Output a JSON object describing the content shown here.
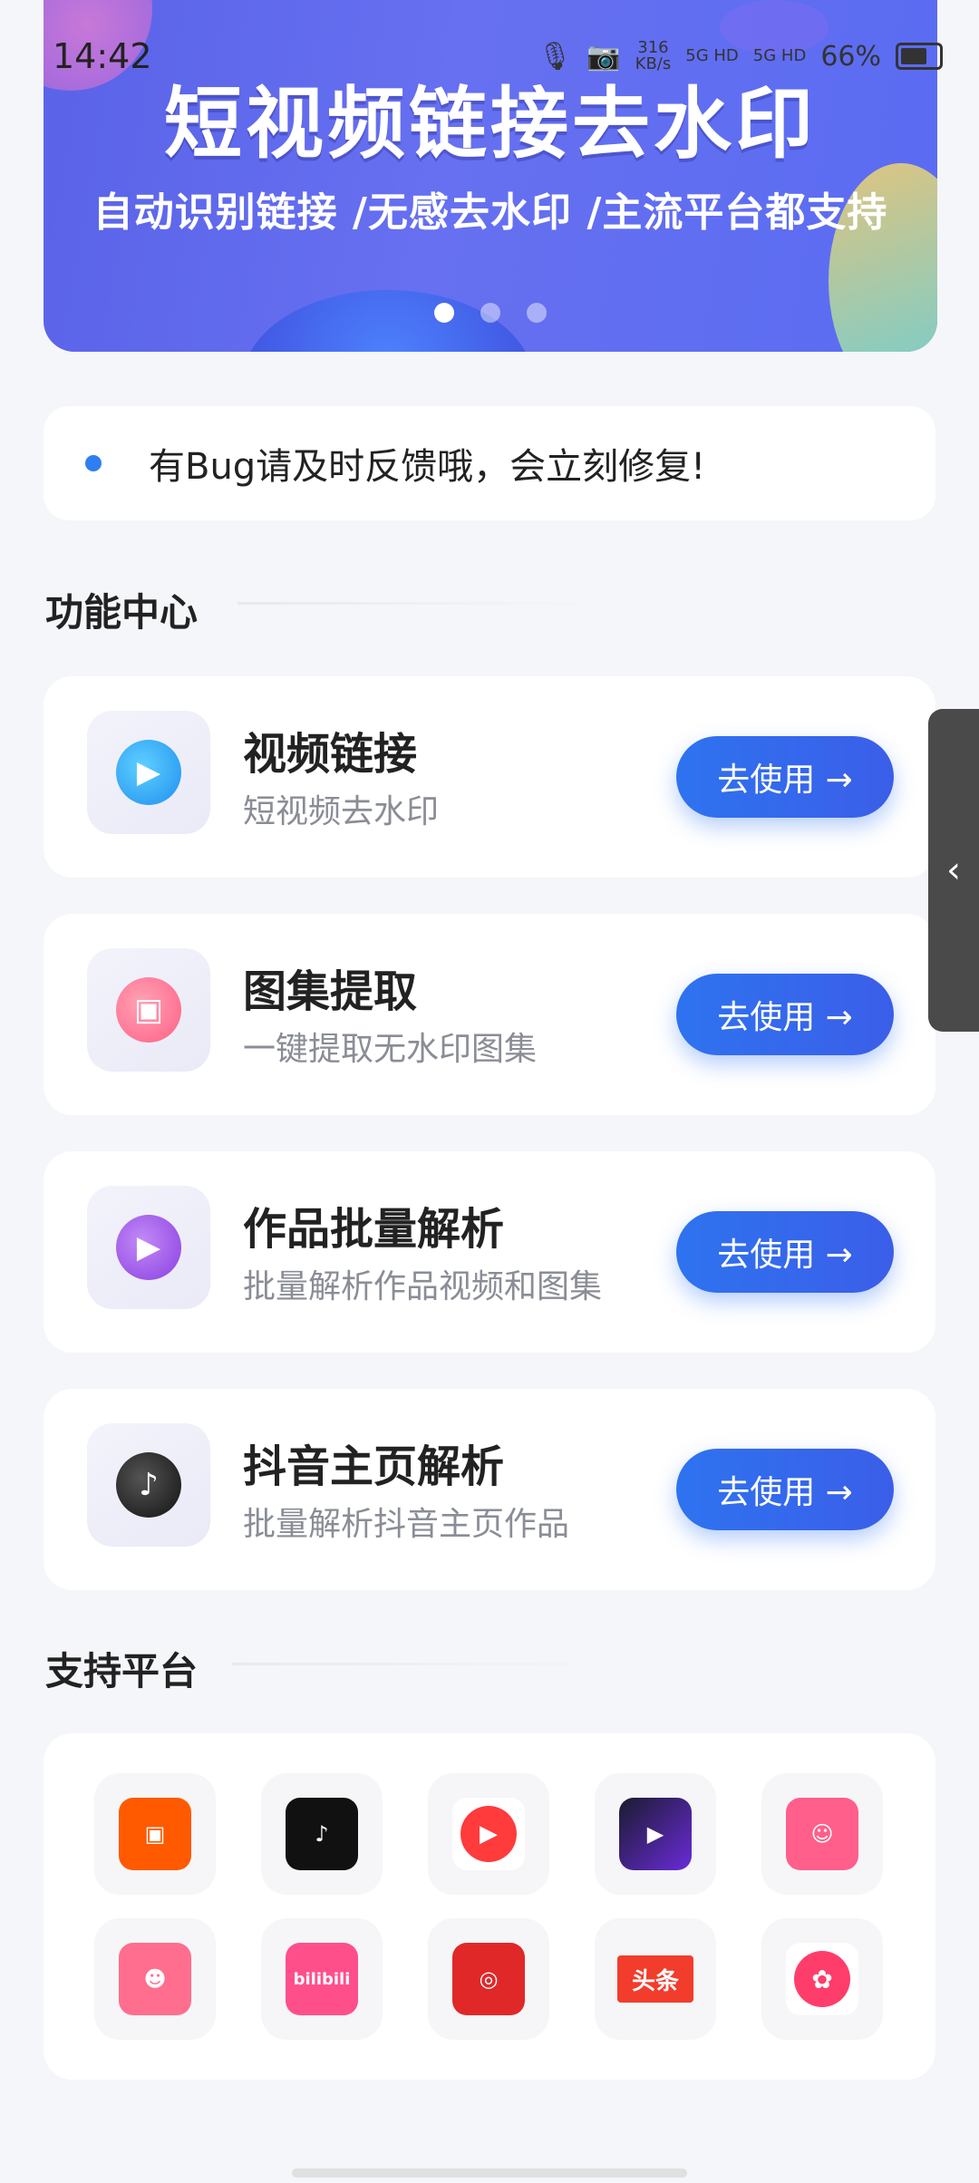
{
  "status_bar": {
    "time": "14:42",
    "net_speed_value": "316",
    "net_speed_unit": "KB/s",
    "signal1": "5G HD",
    "signal2": "5G HD",
    "battery": "66%"
  },
  "banner": {
    "title": "短视频链接去水印",
    "subtitle": "自动识别链接 /无感去水印 /主流平台都支持",
    "slides": 3,
    "active_slide": 1
  },
  "notice": {
    "text": "有Bug请及时反馈哦，会立刻修复!"
  },
  "features": {
    "section_title": "功能中心",
    "items": [
      {
        "title": "视频链接",
        "desc": "短视频去水印",
        "button": "去使用 →",
        "icon": "play-icon",
        "color": "#2aa8f0"
      },
      {
        "title": "图集提取",
        "desc": "一键提取无水印图集",
        "button": "去使用 →",
        "icon": "image-icon",
        "color": "#ff6f8f"
      },
      {
        "title": "作品批量解析",
        "desc": "批量解析作品视频和图集",
        "button": "去使用 →",
        "icon": "film-icon",
        "color": "#9b4fe6"
      },
      {
        "title": "抖音主页解析",
        "desc": "批量解析抖音主页作品",
        "button": "去使用 →",
        "icon": "tiktok-icon",
        "color": "#222222"
      }
    ]
  },
  "platforms": {
    "section_title": "支持平台",
    "items": [
      {
        "name": "kuaishou",
        "icon": "kuaishou-icon",
        "color": "#ff5a00",
        "text": ""
      },
      {
        "name": "douyin",
        "icon": "douyin-icon",
        "color": "#111111",
        "text": ""
      },
      {
        "name": "weishi",
        "icon": "weishi-icon",
        "color": "#ff3b3b",
        "text": ""
      },
      {
        "name": "video-app",
        "icon": "video-app-icon",
        "color": "#6a2bd9",
        "text": ""
      },
      {
        "name": "pipix",
        "icon": "pipix-icon",
        "color": "#ff5f8a",
        "text": ""
      },
      {
        "name": "zuiyou",
        "icon": "zuiyou-icon",
        "color": "#ff6e8e",
        "text": ""
      },
      {
        "name": "bilibili",
        "icon": "bilibili-icon",
        "color": "#ff4f8b",
        "text": "bilibili"
      },
      {
        "name": "netease-music",
        "icon": "netease-music-icon",
        "color": "#e02828",
        "text": ""
      },
      {
        "name": "toutiao",
        "icon": "toutiao-icon",
        "color": "#f23c2c",
        "text": "头条"
      },
      {
        "name": "pipigaoxiao",
        "icon": "pipigaoxiao-icon",
        "color": "#ff3d6a",
        "text": ""
      }
    ]
  }
}
